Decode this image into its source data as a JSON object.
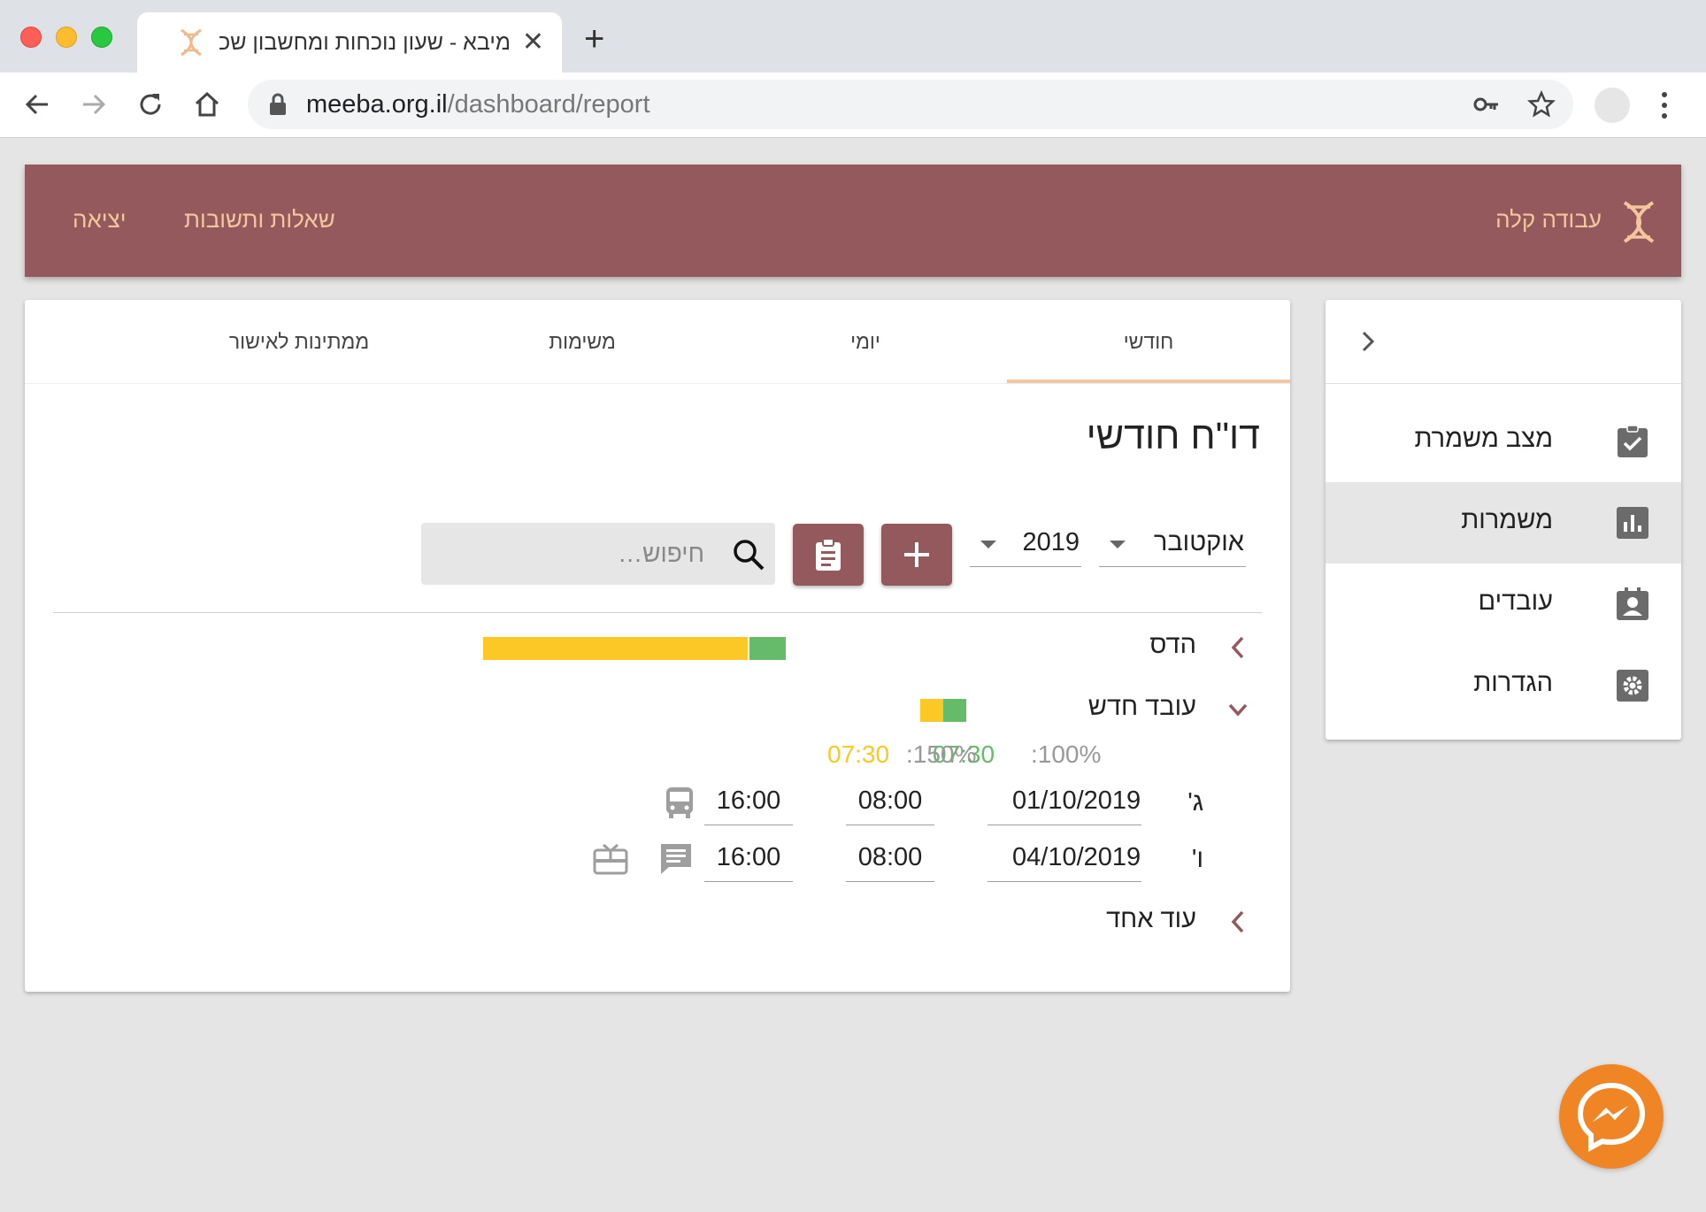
{
  "browser": {
    "tab_title": "מיבא - שעון נוכחות ומחשבון שכר",
    "url_host": "meeba.org.il",
    "url_path": "/dashboard/report"
  },
  "appbar": {
    "brand_name": "עבודה קלה",
    "faq_label": "שאלות ותשובות",
    "exit_label": "יציאה"
  },
  "sidebar": {
    "items": [
      {
        "label": "מצב משמרת",
        "icon": "clipboard-check-icon",
        "active": false
      },
      {
        "label": "משמרות",
        "icon": "bar-chart-icon",
        "active": true
      },
      {
        "label": "עובדים",
        "icon": "badge-icon",
        "active": false
      },
      {
        "label": "הגדרות",
        "icon": "settings-icon",
        "active": false
      }
    ]
  },
  "main": {
    "tabs": [
      {
        "label": "חודשי",
        "active": true
      },
      {
        "label": "יומי",
        "active": false
      },
      {
        "label": "משימות",
        "active": false
      },
      {
        "label": "ממתינות לאישור",
        "active": false
      }
    ],
    "title": "דו\"ח חודשי",
    "month": "אוקטובר",
    "year": "2019",
    "search_placeholder": "חיפוש…"
  },
  "employees": [
    {
      "name": "הדס",
      "expanded": false,
      "regular_share": 0.12,
      "overtime_share": 0.88
    },
    {
      "name": "עובד חדש",
      "expanded": true,
      "summary": {
        "rate100_label": ":100%",
        "rate100_value": "07:30",
        "rate150_label": ":150%",
        "rate150_value": "07:30"
      },
      "shifts": [
        {
          "day": "ג'",
          "date": "01/10/2019",
          "start": "08:00",
          "end": "16:00",
          "icons": [
            "bus-icon"
          ]
        },
        {
          "day": "ו'",
          "date": "04/10/2019",
          "start": "08:00",
          "end": "16:00",
          "icons": [
            "comment-icon",
            "gift-card-icon"
          ]
        }
      ]
    },
    {
      "name": "עוד אחד",
      "expanded": false
    }
  ],
  "colors": {
    "brand": "#93595c",
    "accent": "#f5c69e",
    "regular_hours": "#65bb69",
    "overtime_hours": "#fcc826",
    "messenger": "#f08526"
  }
}
